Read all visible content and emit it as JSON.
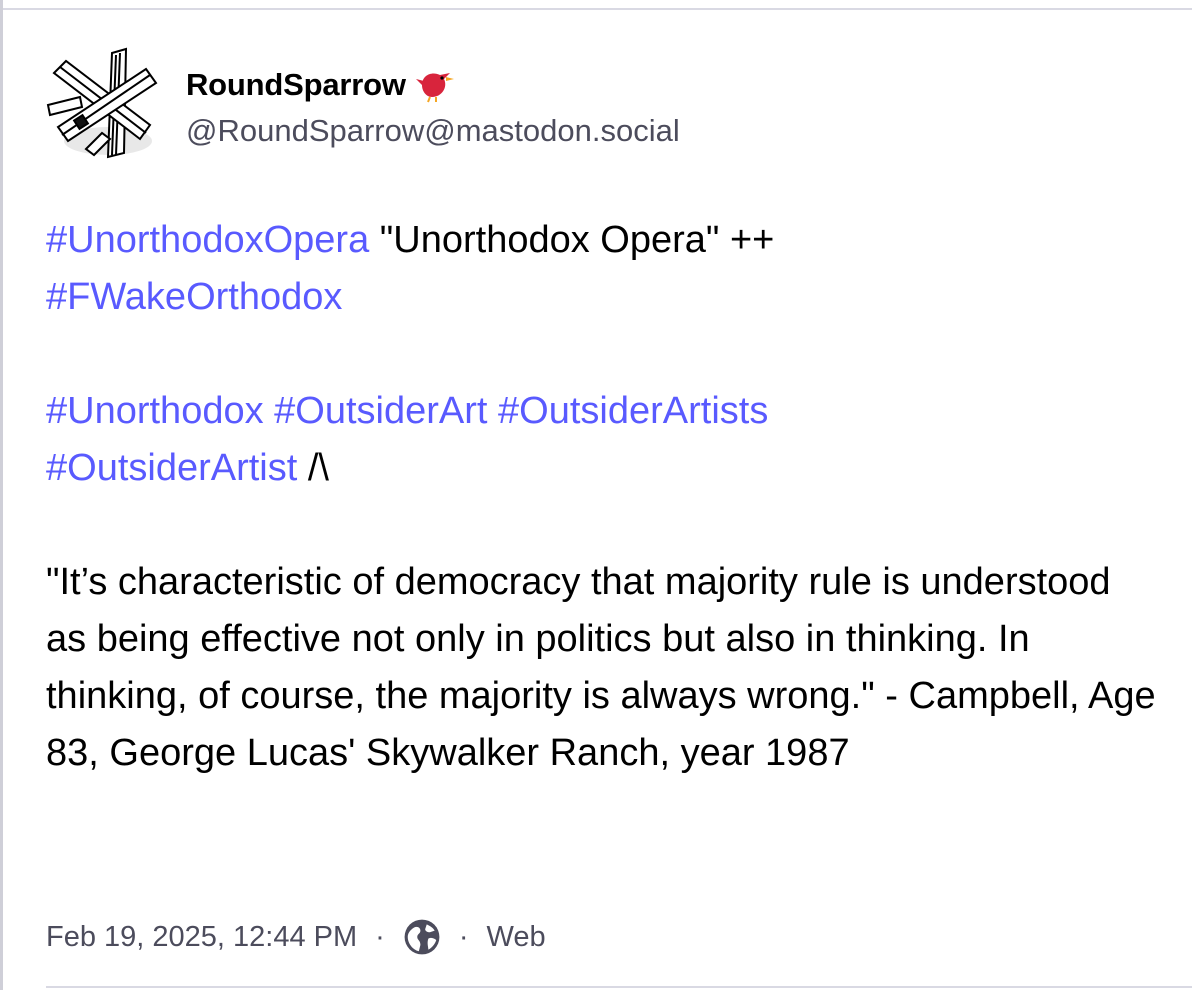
{
  "account": {
    "display_name": "RoundSparrow",
    "handle": "@RoundSparrow@mastodon.social",
    "avatar_icon": "crossed-beams-avatar-icon",
    "badge_icon": "red-bird-emoji-icon"
  },
  "post": {
    "line1": {
      "hashtag1": "#UnorthodoxOpera",
      "text1": " \"Unorthodox Opera\" ++ ",
      "hashtag2": "#FWakeOrthodox"
    },
    "line2": {
      "hashtag1": "#Unorthodox",
      "hashtag2": "#OutsiderArt",
      "hashtag3": "#OutsiderArtists",
      "hashtag4": "#OutsiderArtist",
      "text1": " /\\"
    },
    "quote": "\"It’s characteristic of democracy that majority rule is understood as being effective not only in politics but also in thinking. In thinking, of course, the majority is always wrong.\" - Campbell, Age 83, George Lucas' Skywalker Ranch, year 1987"
  },
  "meta": {
    "timestamp": "Feb 19, 2025, 12:44 PM",
    "separator": "·",
    "visibility_icon": "globe-icon",
    "application": "Web"
  },
  "colors": {
    "hashtag": "#595aff",
    "secondary_text": "#4c4c5c",
    "divider": "#d9d9e3"
  }
}
